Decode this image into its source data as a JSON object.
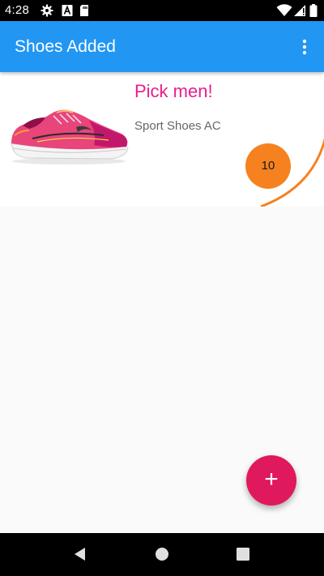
{
  "status_bar": {
    "time": "4:28",
    "icons": [
      "gear-icon",
      "a-icon",
      "sd-card-icon",
      "wifi-icon",
      "signal-icon",
      "battery-icon"
    ]
  },
  "app_bar": {
    "title": "Shoes Added",
    "background_color": "#2196f3",
    "overflow_icon": "more-vert-icon"
  },
  "card": {
    "title": "Pick men!",
    "subtitle": "Sport Shoes AC",
    "count": "10",
    "title_color": "#e91e8c",
    "badge_color": "#f5821f",
    "accent_arc_color": "#f5821f"
  },
  "fab": {
    "label": "+",
    "icon": "add-icon",
    "color": "#e0185e"
  },
  "nav_bar": {
    "icons": [
      "back-icon",
      "home-icon",
      "recents-icon"
    ]
  }
}
